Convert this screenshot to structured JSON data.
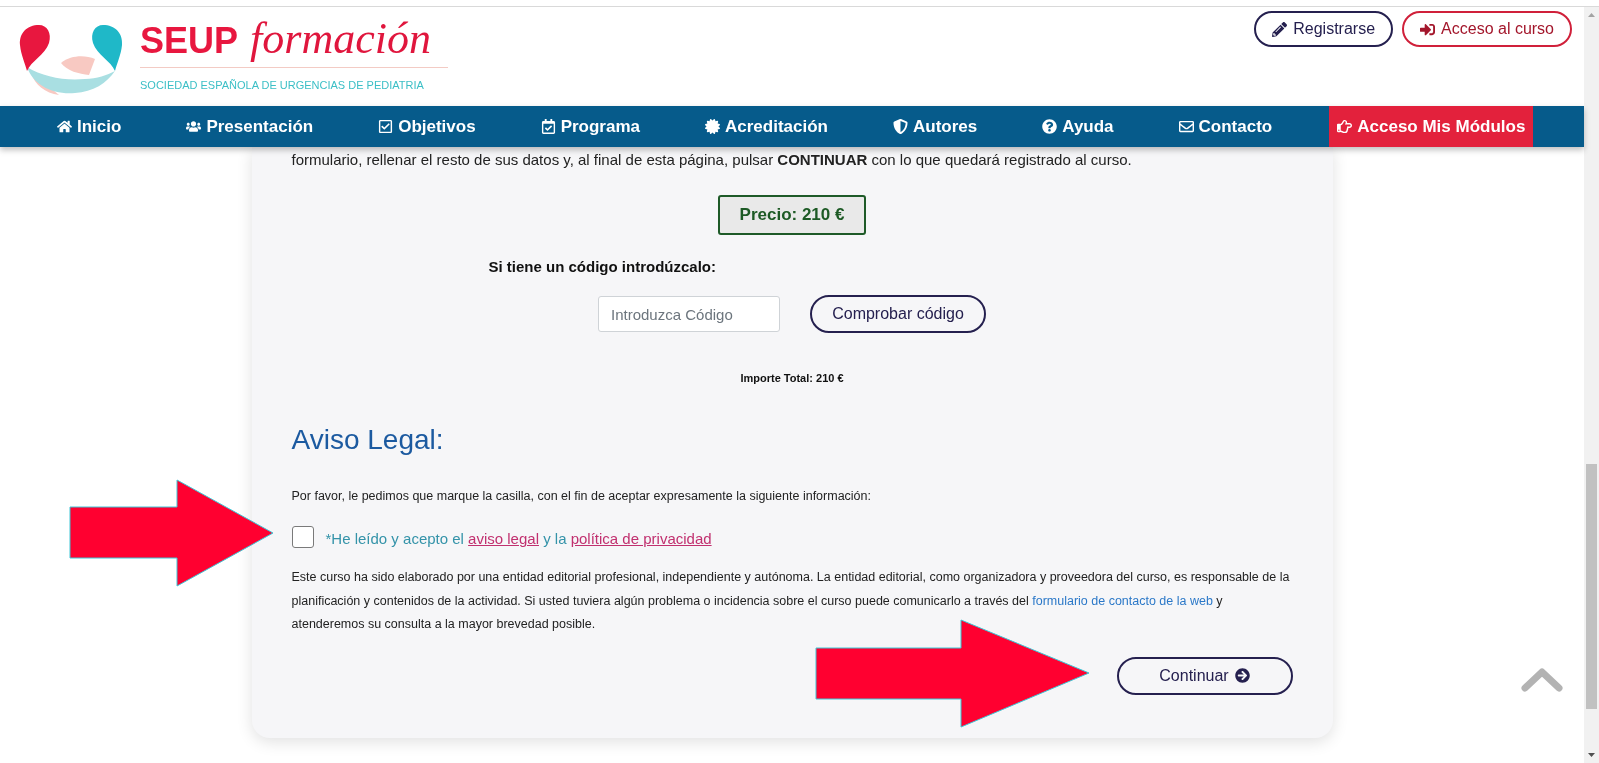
{
  "header": {
    "logo": {
      "name": "SEUP",
      "script": "formación",
      "tagline": "SOCIEDAD ESPAÑOLA DE URGENCIAS DE PEDIATRIA"
    },
    "buttons": [
      {
        "label": "Registrarse",
        "kind": "outline"
      },
      {
        "label": "Acceso al curso",
        "kind": "accent"
      }
    ]
  },
  "nav": {
    "items": [
      {
        "label": "Inicio",
        "highlighted": false
      },
      {
        "label": "Presentación",
        "highlighted": false
      },
      {
        "label": "Objetivos",
        "highlighted": false
      },
      {
        "label": "Programa",
        "highlighted": false
      },
      {
        "label": "Acreditación",
        "highlighted": false
      },
      {
        "label": "Autores",
        "highlighted": false
      },
      {
        "label": "Ayuda",
        "highlighted": false
      },
      {
        "label": "Contacto",
        "highlighted": false
      },
      {
        "label": "Acceso Mis Módulos",
        "highlighted": true
      }
    ]
  },
  "registration": {
    "intro": "formulario, rellenar el resto de sus datos y, al final de esta página, pulsar **CONTINUAR** con lo que quedará registrado al curso.",
    "price": "Precio: 210 €",
    "code_prompt": "Si tiene un código introdúzcalo:",
    "code_field": {
      "placeholder": "Introduzca Código"
    },
    "check_button": "Comprobar código",
    "total": "Importe Total: 210 €"
  },
  "legal": {
    "title": "Aviso Legal:",
    "instruction": "Por favor, le pedimos que marque la casilla, con el fin de aceptar expresamente la siguiente información:",
    "consent": {
      "checked": false,
      "segments": [
        {
          "kind": "text",
          "text": "*He leído y acepto el "
        },
        {
          "kind": "link",
          "text": "aviso legal"
        },
        {
          "kind": "text",
          "text": " y la "
        },
        {
          "kind": "link",
          "text": "política de privacidad"
        }
      ]
    },
    "disclaimer": [
      {
        "kind": "text",
        "text": "Este curso ha sido elaborado por una entidad editorial profesional, independiente y autónoma. La entidad editorial, como organizadora y proveedora del curso, es responsable de la planificación y contenidos de la actividad. Si usted tuviera algún problema o incidencia sobre el curso puede comunicarlo a través del "
      },
      {
        "kind": "link",
        "text": "formulario de contacto de la web"
      },
      {
        "kind": "text",
        "text": " y atenderemos su consulta a la mayor brevedad posible."
      }
    ]
  },
  "continue_button": {
    "label": "Continuar"
  }
}
